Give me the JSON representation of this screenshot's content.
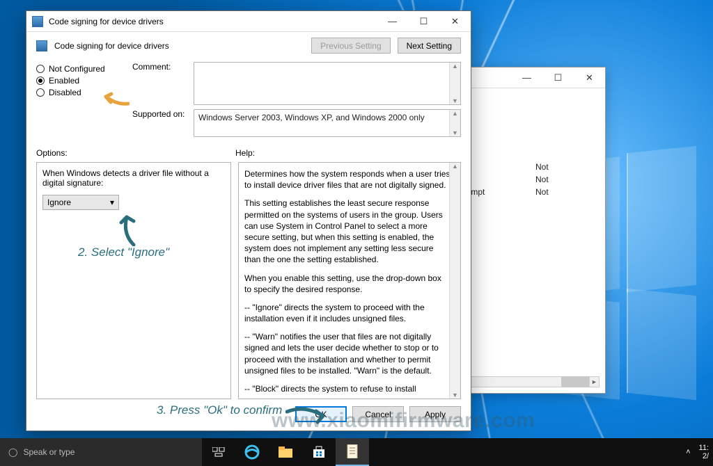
{
  "window": {
    "title": "Code signing for device drivers",
    "heading": "Code signing for device drivers",
    "prev_setting": "Previous Setting",
    "next_setting": "Next Setting"
  },
  "states": {
    "not_configured": "Not Configured",
    "enabled": "Enabled",
    "disabled": "Disabled",
    "selected": "Enabled"
  },
  "labels": {
    "comment": "Comment:",
    "supported_on": "Supported on:",
    "options": "Options:",
    "help": "Help:"
  },
  "supported_on_text": "Windows Server 2003, Windows XP, and Windows 2000 only",
  "options_pane": {
    "prompt": "When Windows detects a driver file without a digital signature:",
    "selected_value": "Ignore"
  },
  "help_text": {
    "p1": "Determines how the system responds when a user tries to install device driver files that are not digitally signed.",
    "p2": "This setting establishes the least secure response permitted on the systems of users in the group. Users can use System in Control Panel to select a more secure setting, but when this setting is enabled, the system does not implement any setting less secure than the one the setting established.",
    "p3": "When you enable this setting, use the drop-down box to specify the desired response.",
    "p4": "--   \"Ignore\" directs the system to proceed with the installation even if it includes unsigned files.",
    "p5": "--   \"Warn\" notifies the user that files are not digitally signed and lets the user decide whether to stop or to proceed with the installation and whether to permit unsigned files to be installed. \"Warn\" is the default.",
    "p6": "--   \"Block\" directs the system to refuse to install unsigned files."
  },
  "buttons": {
    "ok": "OK",
    "cancel": "Cancel",
    "apply": "Apply"
  },
  "annotations": {
    "step2": "2. Select \"Ignore\"",
    "step3": "3. Press \"Ok\" to confirm"
  },
  "watermark": "www.xiaomifirmware.com",
  "bgwindow": {
    "rows": [
      {
        "a": "",
        "b": "Not"
      },
      {
        "a": "",
        "b": "Not"
      },
      {
        "a": "prompt",
        "b": "Not"
      }
    ]
  },
  "taskbar": {
    "search_placeholder": "Speak or type",
    "time": "11:",
    "date": "2/"
  }
}
